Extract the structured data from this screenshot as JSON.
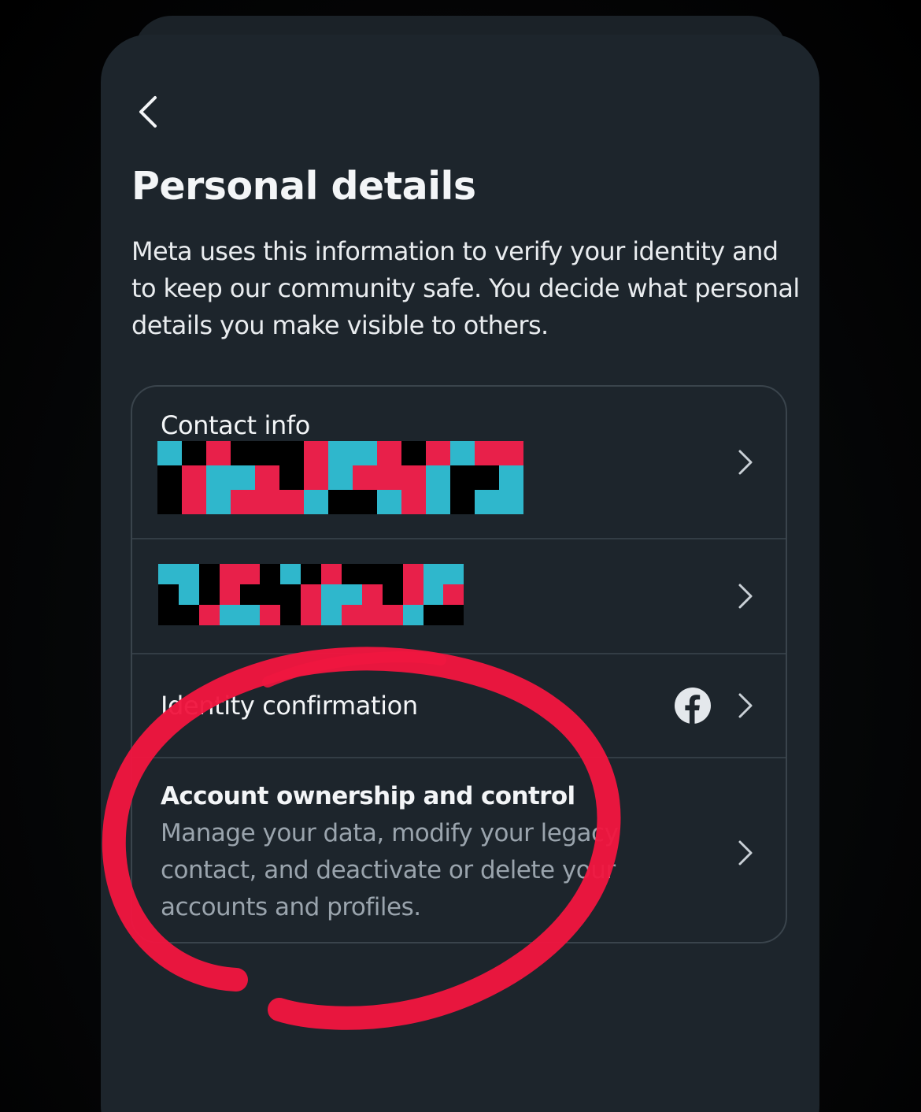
{
  "header": {
    "back_icon": "chevron-left-icon",
    "title": "Personal details",
    "description": "Meta uses this information to verify your identity and to keep our community safe. You decide what personal details you make visible to others."
  },
  "settings_list": [
    {
      "id": "contact-info",
      "title": "Contact info",
      "value": "[redacted]",
      "icon": "chevron-right-icon"
    },
    {
      "id": "redacted-detail",
      "value": "[redacted]",
      "icon": "chevron-right-icon"
    },
    {
      "id": "identity-confirmation",
      "title": "Identity confirmation",
      "badge_icon": "facebook-icon",
      "icon": "chevron-right-icon"
    },
    {
      "id": "account-ownership",
      "title": "Account ownership and control",
      "subtitle": "Manage your data, modify your legacy contact, and deactivate or delete your accounts and profiles.",
      "icon": "chevron-right-icon"
    }
  ],
  "annotation": {
    "type": "hand-drawn circle",
    "color": "#f0163f"
  },
  "colors": {
    "background": "#000000",
    "sheet": "#1d252c",
    "card_border": "#3a444c",
    "text_primary": "#f3f5f7",
    "text_secondary": "#9aa4ad",
    "redaction": [
      "#e8204a",
      "#2fb7cc",
      "#000000"
    ]
  }
}
